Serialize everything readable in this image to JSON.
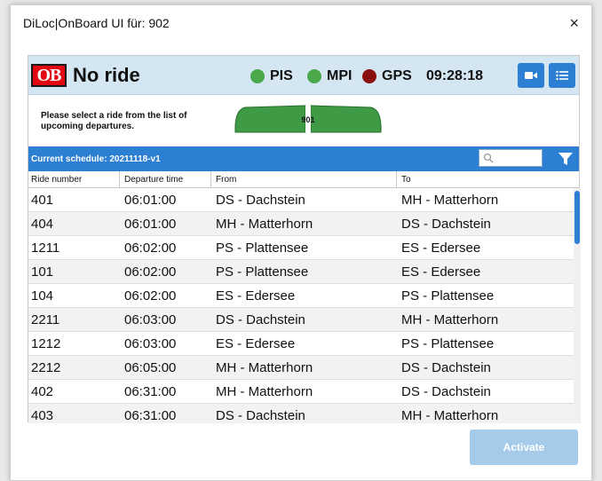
{
  "dialog": {
    "title": "DiLoc|OnBoard UI für: 902",
    "close_glyph": "×"
  },
  "status": {
    "logo_text": "OB",
    "ride_status": "No ride",
    "indicators": [
      {
        "label": "PIS",
        "color": "#4aa84a"
      },
      {
        "label": "MPI",
        "color": "#4aa84a"
      },
      {
        "label": "GPS",
        "color": "#8b0f0f"
      }
    ],
    "time": "09:28:18",
    "buttons": [
      "video-camera-icon",
      "list-icon"
    ],
    "accent": "#2d7fd3"
  },
  "info": {
    "hint": "Please select a ride from the list of upcoming departures.",
    "train_number": "901",
    "train_color": "#3e9a45"
  },
  "schedule": {
    "label": "Current schedule: 20211118-v1",
    "search_placeholder": ""
  },
  "table": {
    "columns": [
      "Ride number",
      "Departure time",
      "From",
      "To"
    ],
    "rows": [
      [
        "401",
        "06:01:00",
        "DS - Dachstein",
        "MH - Matterhorn"
      ],
      [
        "404",
        "06:01:00",
        "MH - Matterhorn",
        "DS - Dachstein"
      ],
      [
        "1211",
        "06:02:00",
        "PS - Plattensee",
        "ES - Edersee"
      ],
      [
        "101",
        "06:02:00",
        "PS - Plattensee",
        "ES - Edersee"
      ],
      [
        "104",
        "06:02:00",
        "ES - Edersee",
        "PS - Plattensee"
      ],
      [
        "2211",
        "06:03:00",
        "DS - Dachstein",
        "MH - Matterhorn"
      ],
      [
        "1212",
        "06:03:00",
        "ES - Edersee",
        "PS - Plattensee"
      ],
      [
        "2212",
        "06:05:00",
        "MH - Matterhorn",
        "DS - Dachstein"
      ],
      [
        "402",
        "06:31:00",
        "MH - Matterhorn",
        "DS - Dachstein"
      ],
      [
        "403",
        "06:31:00",
        "DS - Dachstein",
        "MH - Matterhorn"
      ]
    ]
  },
  "actions": {
    "activate_label": "Activate",
    "activate_color": "#a6cbea"
  }
}
